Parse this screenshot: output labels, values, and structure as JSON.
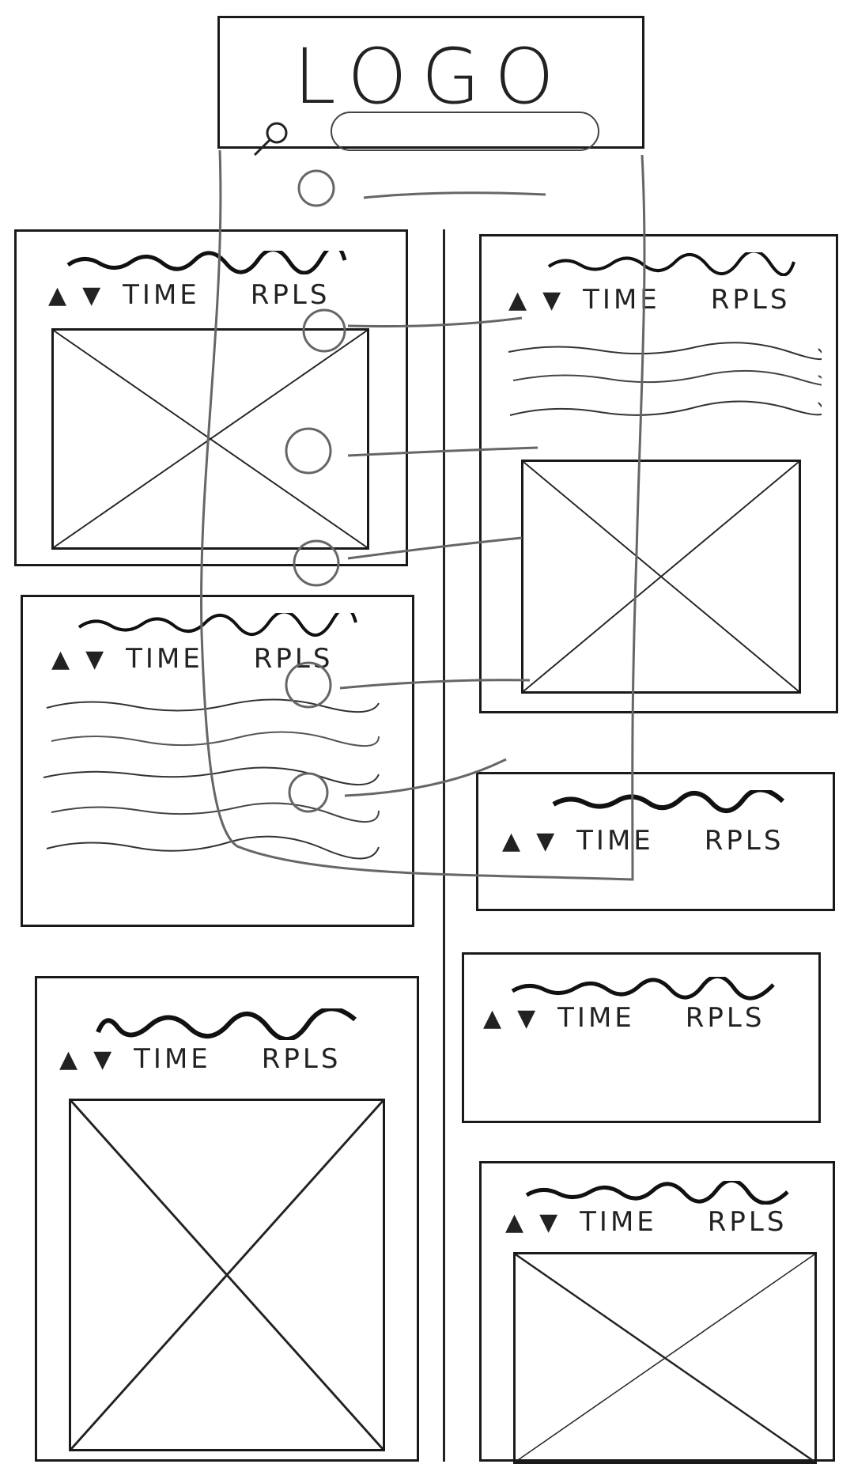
{
  "header": {
    "logo_text": "LOGO"
  },
  "cards": [
    {
      "up": "▲",
      "down": "▼",
      "time": "TIME",
      "replies": "RPLS"
    },
    {
      "up": "▲",
      "down": "▼",
      "time": "TIME",
      "replies": "RPLS"
    },
    {
      "up": "▲",
      "down": "▼",
      "time": "TIME",
      "replies": "RPLS"
    },
    {
      "up": "▲",
      "down": "▼",
      "time": "TIME",
      "replies": "RPLS"
    },
    {
      "up": "▲",
      "down": "▼",
      "time": "TIME",
      "replies": "RPLS"
    },
    {
      "up": "▲",
      "down": "▼",
      "time": "TIME",
      "replies": "RPLS"
    },
    {
      "up": "▲",
      "down": "▼",
      "time": "TIME",
      "replies": "RPLS"
    }
  ]
}
